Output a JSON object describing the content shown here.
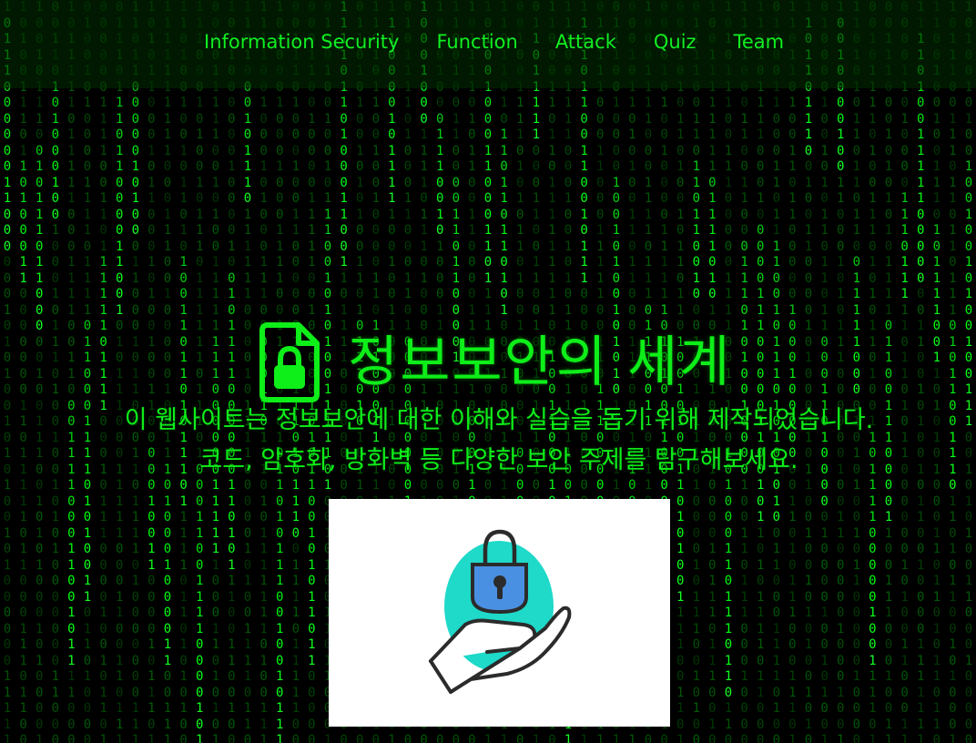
{
  "nav": {
    "items": [
      {
        "label": "Information Security"
      },
      {
        "label": "Function"
      },
      {
        "label": "Attack"
      },
      {
        "label": "Quiz"
      },
      {
        "label": "Team"
      }
    ]
  },
  "hero": {
    "title": "정보보안의 세계",
    "title_icon": "document-lock-icon",
    "description_line1": "이 웹사이트는 정보보안에 대한 이해와 실습을 돕기 위해 제작되었습니다.",
    "description_line2": "코드, 암호화, 방화벽 등 다양한 보안 주제를 탐구해보세요.",
    "image_icon": "hand-holding-padlock-icon"
  },
  "background": {
    "effect": "matrix-binary-rain",
    "glyphs": [
      "0",
      "1"
    ]
  },
  "colors": {
    "background": "#000000",
    "primary_green": "#0eee19",
    "nav_bar": "#002d00",
    "padlock_blue": "#4a90e2",
    "teal_circle": "#1fd9c9"
  }
}
